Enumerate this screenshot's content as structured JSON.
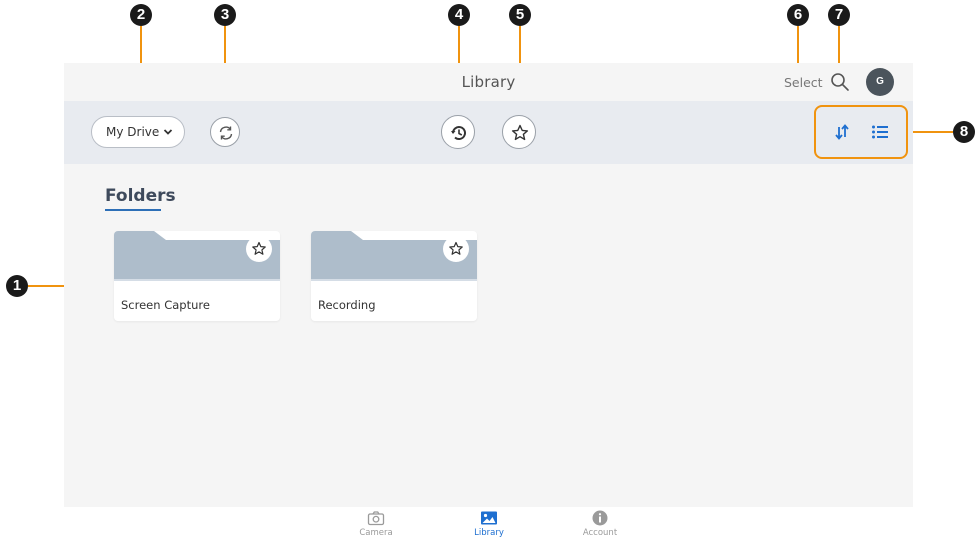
{
  "header": {
    "title": "Library",
    "select_label": "Select",
    "avatar_initial": "G"
  },
  "toolbar": {
    "drive_label": "My Drive"
  },
  "main": {
    "folders_heading": "Folders",
    "folders": [
      {
        "name": "Screen Capture"
      },
      {
        "name": "Recording"
      }
    ]
  },
  "bottom_nav": {
    "items": [
      {
        "label": "Camera",
        "icon": "camera-icon"
      },
      {
        "label": "Library",
        "icon": "image-icon"
      },
      {
        "label": "Account",
        "icon": "info-icon"
      }
    ],
    "active_color": "#1e6fd0",
    "inactive_color": "#9a9a9a"
  },
  "callouts": [
    "1",
    "2",
    "3",
    "4",
    "5",
    "6",
    "7",
    "8"
  ],
  "colors": {
    "accent": "#f0930f",
    "primary_blue": "#1e6fd0",
    "folder_gray": "#aebdcb",
    "toolbar_bg": "#e8ebf0"
  }
}
